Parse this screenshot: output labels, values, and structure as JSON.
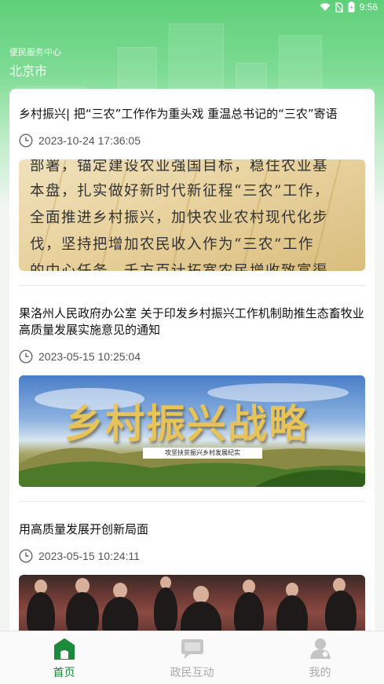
{
  "status_bar": {
    "time": "9:56",
    "battery_icon": "battery-icon",
    "wifi_icon": "wifi-icon",
    "signal_icon": "no-sim-icon"
  },
  "location": {
    "subtitle": "便民服务中心",
    "city": "北京市"
  },
  "articles": [
    {
      "title": "乡村振兴| 把“三农”工作作为重头戏 重温总书记的“三农”寄语",
      "time": "2023-10-24 17:36:05",
      "thumb_lines": [
        "部署，锚定建设农业强国目标，稳住农业基",
        "本盘，扎实做好新时代新征程“三农”工作，",
        "全面推进乡村振兴，加快农业农村现代化步",
        "伐，坚持把增加农民收入作为“三农”工作",
        "的中心任务，千方百计拓宽农民增收致富渠"
      ]
    },
    {
      "title": "果洛州人民政府办公室 关于印发乡村振兴工作机制助推生态畜牧业 高质量发展实施意见的通知",
      "time": "2023-05-15 10:25:04",
      "thumb_title": "乡村振兴战略",
      "thumb_tag": "攻坚扶贫振兴乡村发展纪实"
    },
    {
      "title": "用高质量发展开创新局面",
      "time": "2023-05-15 10:24:11"
    }
  ],
  "tabs": [
    {
      "label": "首页",
      "icon": "home-icon",
      "active": true
    },
    {
      "label": "政民互动",
      "icon": "chat-icon",
      "active": false
    },
    {
      "label": "我的",
      "icon": "user-icon",
      "active": false
    }
  ],
  "colors": {
    "accent": "#1c8a3c",
    "header": "#5fd07a",
    "inactive": "#aaaaaa"
  }
}
